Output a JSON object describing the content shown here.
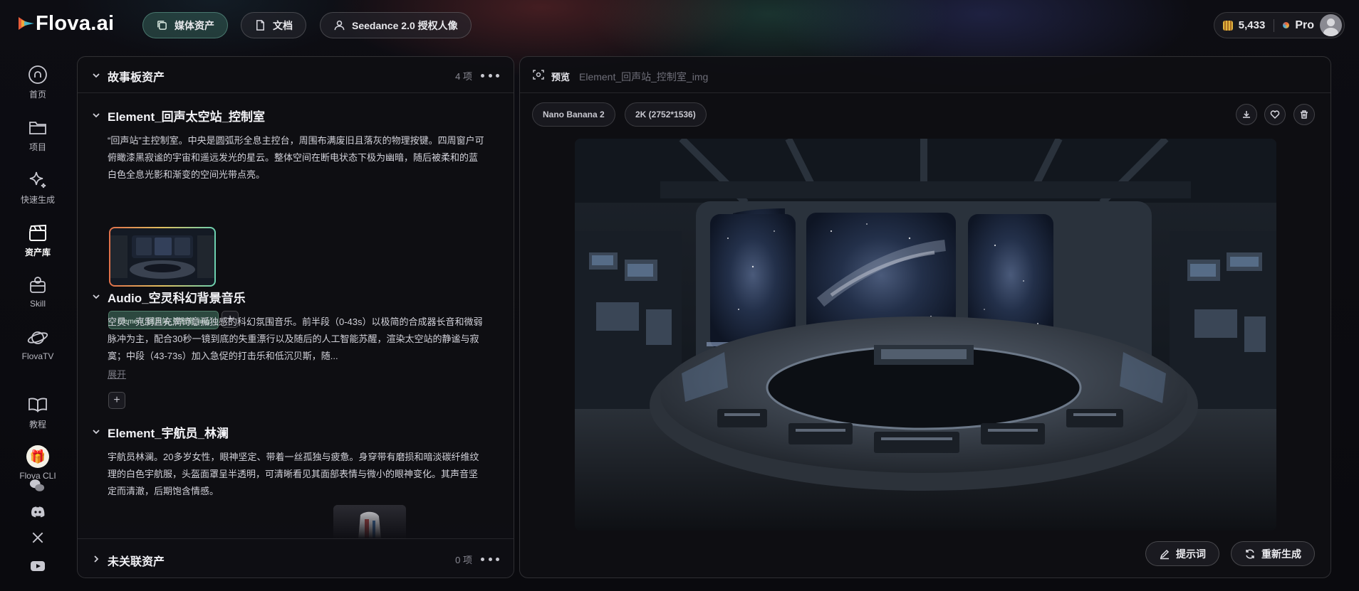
{
  "app": {
    "logo_text": "Flova.ai"
  },
  "topnav": {
    "items": [
      {
        "label": "媒体资产",
        "icon": "copy-icon",
        "active": true
      },
      {
        "label": "文档",
        "icon": "document-icon",
        "active": false
      },
      {
        "label": "Seedance 2.0 授权人像",
        "icon": "person-icon",
        "active": false
      }
    ]
  },
  "account": {
    "credits": "5,433",
    "plan": "Pro"
  },
  "sidebar": {
    "items": [
      {
        "label": "首页",
        "icon": "home-icon"
      },
      {
        "label": "项目",
        "icon": "folder-icon"
      },
      {
        "label": "快速生成",
        "icon": "sparkle-icon"
      },
      {
        "label": "资产库",
        "icon": "clapperboard-icon",
        "active": true
      },
      {
        "label": "Skill",
        "icon": "skill-icon"
      },
      {
        "label": "FlovaTV",
        "icon": "planet-icon"
      },
      {
        "label": "教程",
        "icon": "book-icon"
      },
      {
        "label": "Flova CLI",
        "icon": "gift-icon"
      }
    ],
    "social": [
      "wechat-icon",
      "discord-icon",
      "x-icon",
      "youtube-icon"
    ]
  },
  "storyboard": {
    "title": "故事板资产",
    "count": "4 项",
    "sections": [
      {
        "title": "Element_回声太空站_控制室",
        "description": "“回声站”主控制室。中央是圆弧形全息主控台，周围布满废旧且落灰的物理按键。四周窗户可俯瞰漆黑寂谧的宇宙和遥远发光的星云。整体空间在断电状态下极为幽暗，随后被柔和的蓝白色全息光影和渐变的空间光带点亮。",
        "tag": "Element_回声站_控制室_img"
      },
      {
        "title": "Audio_空灵科幻背景音乐",
        "description": "空灵、克制且充满诗意孤独感的科幻氛围音乐。前半段（0-43s）以极简的合成器长音和微弱脉冲为主，配合30秒一镜到底的失重漂行以及随后的人工智能苏醒，渲染太空站的静谧与寂寞；中段（43-73s）加入急促的打击乐和低沉贝斯，随...",
        "expand": "展开"
      },
      {
        "title": "Element_宇航员_林澜",
        "description": "宇航员林澜。20多岁女性，眼神坚定、带着一丝孤独与疲惫。身穿带有磨损和暗淡碳纤维纹理的白色宇航服，头盔面罩呈半透明，可清晰看见其面部表情与微小的眼神变化。其声音坚定而清澈，后期饱含情感。"
      }
    ],
    "unlinked": {
      "title": "未关联资产",
      "count": "0 项"
    }
  },
  "preview": {
    "label": "预览",
    "name": "Element_回声站_控制室_img",
    "model": "Nano Banana 2",
    "resolution": "2K (2752*1536)",
    "actions": {
      "prompt": "提示词",
      "regenerate": "重新生成"
    }
  },
  "colors": {
    "accent": "#5ea894",
    "background": "#0b0b10",
    "panel": "#0e0e13"
  }
}
